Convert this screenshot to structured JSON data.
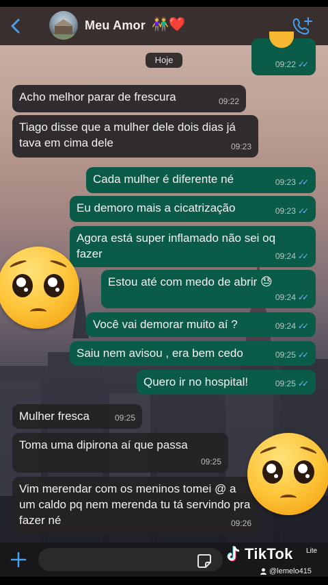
{
  "header": {
    "contact_name": "Meu Amor",
    "name_emoji": "👫❤️"
  },
  "date_label": "Hoje",
  "messages": [
    {
      "dir": "out",
      "text": "",
      "time": "09:22"
    },
    {
      "dir": "in",
      "text": "Acho melhor parar de frescura",
      "time": "09:22"
    },
    {
      "dir": "in",
      "text": "Tiago disse que a mulher dele dois dias já tava em cima dele",
      "time": "09:23"
    },
    {
      "dir": "out",
      "text": "Cada mulher é diferente né",
      "time": "09:23"
    },
    {
      "dir": "out",
      "text": "Eu demoro mais a cicatrização",
      "time": "09:23"
    },
    {
      "dir": "out",
      "text": "Agora está super inflamado não sei oq fazer",
      "time": "09:24"
    },
    {
      "dir": "out",
      "text": "Estou até com medo de abrir 😓",
      "time": "09:24"
    },
    {
      "dir": "out",
      "text": "Você vai demorar muito aí ?",
      "time": "09:24"
    },
    {
      "dir": "out",
      "text": "Saiu nem avisou , era bem cedo",
      "time": "09:25"
    },
    {
      "dir": "out",
      "text": "Quero ir no hospital!",
      "time": "09:25"
    },
    {
      "dir": "in",
      "text": "Mulher fresca",
      "time": "09:25"
    },
    {
      "dir": "in",
      "text": "Toma uma dipirona aí que passa",
      "time": "09:25"
    },
    {
      "dir": "in",
      "text": "Vim merendar com os meninos tomei @ a um caldo pq nem merenda tu tá servindo pra fazer né",
      "time": "09:26"
    }
  ],
  "icons": {
    "back": "chevron-left-icon",
    "call": "add-call-icon",
    "plus": "plus-icon",
    "sticker": "sticker-icon",
    "tiktok": "tiktok-logo-icon"
  },
  "watermark": {
    "brand": "TikTok",
    "lite": "Lite",
    "user": "@lemelo415"
  },
  "colors": {
    "outgoing_bubble": "#0a5c48",
    "incoming_bubble": "#262226",
    "read_ticks": "#6fb7f5",
    "accent_blue": "#6fb7f5"
  }
}
